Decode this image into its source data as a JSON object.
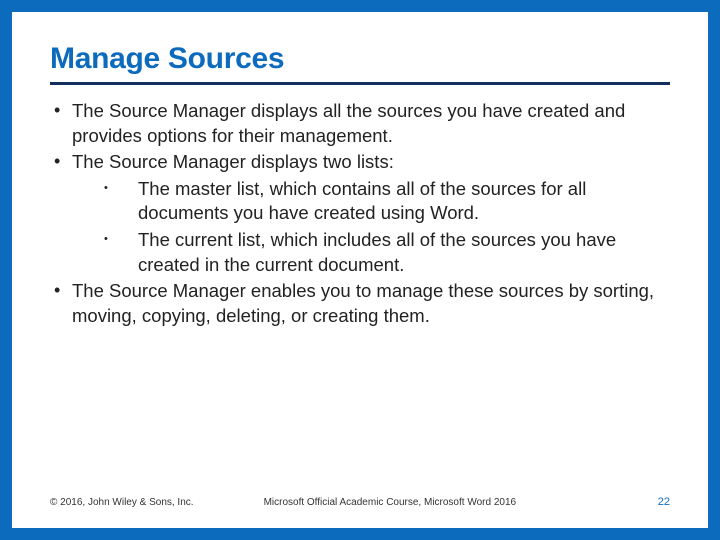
{
  "title": "Manage Sources",
  "bullets": {
    "b1": "The Source Manager displays all the sources you have created and provides options for their management.",
    "b2": "The Source Manager displays two lists:",
    "b2_sub": {
      "s1": "The master list, which contains all of the sources for all documents you have created using Word.",
      "s2": "The current list, which includes all of the sources you have created in the current document."
    },
    "b3": "The Source Manager enables you to manage these sources by sorting, moving, copying, deleting, or creating them."
  },
  "footer": {
    "copyright": "© 2016, John Wiley & Sons, Inc.",
    "course": "Microsoft Official Academic Course, Microsoft Word 2016",
    "page": "22"
  }
}
